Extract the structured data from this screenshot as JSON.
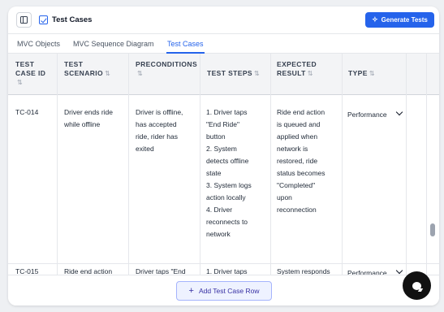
{
  "header": {
    "title": "Test Cases",
    "generate_label": "Generate Tests"
  },
  "tabs": [
    {
      "label": "MVC Objects"
    },
    {
      "label": "MVC Sequence Diagram"
    },
    {
      "label": "Test Cases",
      "active": true
    }
  ],
  "table": {
    "columns": [
      {
        "line1": "TEST",
        "line2": "CASE ID",
        "sort": "⇅"
      },
      {
        "line1": "TEST",
        "line2": "SCENARIO",
        "sort": "⇅"
      },
      {
        "line1": "PRECONDITIONS",
        "line2": "",
        "sort": "⇅"
      },
      {
        "line1": "TEST STEPS",
        "line2": "",
        "sort": "⇅"
      },
      {
        "line1": "EXPECTED",
        "line2": "RESULT",
        "sort": "⇅"
      },
      {
        "line1": "TYPE",
        "line2": "",
        "sort": "⇅"
      }
    ],
    "rows": [
      {
        "id": "TC-014",
        "scenario": [
          "Driver ends ride",
          "while offline"
        ],
        "preconditions": [
          "Driver is offline,",
          "has accepted",
          "ride, rider has",
          "exited"
        ],
        "steps": [
          "1. Driver taps",
          "\"End Ride\"",
          "button",
          "2. System",
          "detects offline",
          "state",
          "3. System logs",
          "action locally",
          "4. Driver",
          "reconnects to",
          "network"
        ],
        "expected": [
          "Ride end action",
          "is queued and",
          "applied when",
          "network is",
          "restored, ride",
          "status becomes",
          "\"Completed\"",
          "upon",
          "reconnection"
        ],
        "type": "Performance"
      },
      {
        "id": "TC-015",
        "scenario": [
          "Ride end action"
        ],
        "preconditions": [
          "Driver taps \"End"
        ],
        "steps": [
          "1. Driver taps"
        ],
        "expected": [
          "System responds"
        ],
        "type": "Performance"
      }
    ]
  },
  "footer": {
    "add_row_label": "Add Test Case Row"
  }
}
